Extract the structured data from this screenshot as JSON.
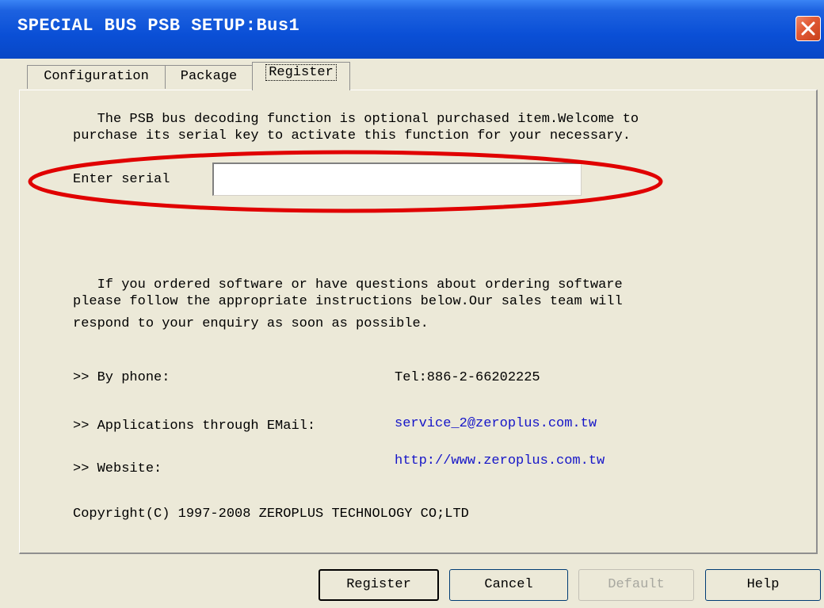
{
  "window": {
    "title": "SPECIAL BUS PSB SETUP:Bus1"
  },
  "tabs": [
    {
      "label": "Configuration"
    },
    {
      "label": "Package"
    },
    {
      "label": "Register"
    }
  ],
  "register": {
    "intro_line1": "   The PSB bus decoding function is optional purchased item.Welcome to",
    "intro_line2": "purchase its serial key to activate this function for your necessary.",
    "serial_label": "Enter serial",
    "serial_value": "",
    "order_line1": "   If you ordered software or have questions about ordering software",
    "order_line2": "please follow the appropriate instructions below.Our sales team will",
    "order_line3": "respond to your enquiry as soon as possible.",
    "phone_label": ">> By phone:",
    "phone_value": "Tel:886-2-66202225",
    "email_label": ">> Applications through EMail:",
    "email_value": "service_2@zeroplus.com.tw",
    "website_label": ">> Website:",
    "website_value": "http://www.zeroplus.com.tw",
    "copyright": "Copyright(C) 1997-2008 ZEROPLUS TECHNOLOGY CO;LTD"
  },
  "buttons": {
    "register": "Register",
    "cancel": "Cancel",
    "default": "Default",
    "help": "Help"
  },
  "colors": {
    "titlebar": "#0a4fd6",
    "dialog_bg": "#ece9d8",
    "annotation_ellipse": "#e00000",
    "link": "#1515c8"
  },
  "icons": {
    "close": "close-icon"
  }
}
